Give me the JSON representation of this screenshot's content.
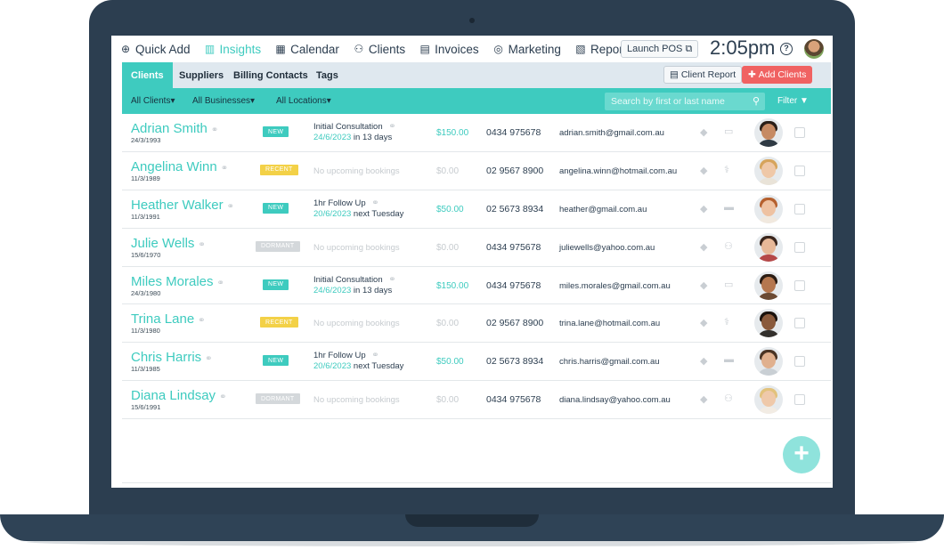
{
  "topnav": {
    "items": [
      {
        "label": "Quick Add",
        "icon": "plus-circle-icon",
        "glyph": "⊕"
      },
      {
        "label": "Insights",
        "icon": "chart-icon",
        "glyph": "▥"
      },
      {
        "label": "Calendar",
        "icon": "calendar-icon",
        "glyph": "▦"
      },
      {
        "label": "Clients",
        "icon": "users-icon",
        "glyph": "⚇"
      },
      {
        "label": "Invoices",
        "icon": "invoice-icon",
        "glyph": "▤"
      },
      {
        "label": "Marketing",
        "icon": "target-icon",
        "glyph": "◎"
      },
      {
        "label": "Reports",
        "icon": "report-icon",
        "glyph": "▧"
      }
    ],
    "active_item": "Insights",
    "launch_pos": "Launch POS",
    "clock": "2:05pm",
    "help": "?"
  },
  "subnav": {
    "tabs": [
      "Clients",
      "Suppliers",
      "Billing Contacts",
      "Tags"
    ],
    "active_tab": "Clients",
    "client_report": "Client Report",
    "add_clients": "Add Clients"
  },
  "filters": {
    "clients": "All Clients",
    "businesses": "All Businesses",
    "locations": "All Locations",
    "search_placeholder": "Search by first or last name",
    "filter": "Filter"
  },
  "colors": {
    "accent": "#3ecbbf",
    "danger": "#f06262",
    "recent": "#f3d147",
    "dormant": "#d4d8db",
    "frame": "#2c3e50"
  },
  "clients": [
    {
      "name": "Adrian Smith",
      "dob": "24/3/1993",
      "status": "NEW",
      "booking_title": "Initial Consultation",
      "booking_date": "24/6/2023",
      "booking_rel": "in 13 days",
      "amount": "$150.00",
      "phone": "0434 975678",
      "email": "adrian.smith@gmail.com.au",
      "type_icon": "monitor-icon",
      "avatar": {
        "skin": "#c68a63",
        "hair": "#2a1f18",
        "shirt": "#2f3a44"
      }
    },
    {
      "name": "Angelina Winn",
      "dob": "11/3/1989",
      "status": "RECENT",
      "booking_none": "No upcoming bookings",
      "amount": "$0.00",
      "phone": "02 9567 8900",
      "email": "angelina.winn@hotmail.com.au",
      "type_icon": "stethoscope-icon",
      "avatar": {
        "skin": "#efc8a8",
        "hair": "#d6a45c",
        "shirt": "#e9e3d8"
      }
    },
    {
      "name": "Heather Walker",
      "dob": "11/3/1991",
      "status": "NEW",
      "booking_title": "1hr Follow Up",
      "booking_date": "20/6/2023",
      "booking_rel": "next Tuesday",
      "amount": "$50.00",
      "phone": "02 5673 8934",
      "email": "heather@gmail.com.au",
      "type_icon": "chat-icon",
      "avatar": {
        "skin": "#eec2a2",
        "hair": "#b5602e",
        "shirt": "#f1e9df"
      }
    },
    {
      "name": "Julie Wells",
      "dob": "15/6/1970",
      "status": "DORMANT",
      "booking_none": "No upcoming bookings",
      "amount": "$0.00",
      "phone": "0434 975678",
      "email": "juliewells@yahoo.com.au",
      "type_icon": "group-icon",
      "avatar": {
        "skin": "#e7b898",
        "hair": "#3a261d",
        "shirt": "#b54848"
      }
    },
    {
      "name": "Miles Morales",
      "dob": "24/3/1980",
      "status": "NEW",
      "booking_title": "Initial Consultation",
      "booking_date": "24/6/2023",
      "booking_rel": "in 13 days",
      "amount": "$150.00",
      "phone": "0434 975678",
      "email": "miles.morales@gmail.com.au",
      "type_icon": "monitor-icon",
      "avatar": {
        "skin": "#b5774f",
        "hair": "#2b1c13",
        "shirt": "#6b4a33"
      }
    },
    {
      "name": "Trina Lane",
      "dob": "11/3/1980",
      "status": "RECENT",
      "booking_none": "No upcoming bookings",
      "amount": "$0.00",
      "phone": "02 9567 8900",
      "email": "trina.lane@hotmail.com.au",
      "type_icon": "stethoscope-icon",
      "avatar": {
        "skin": "#8a5a3c",
        "hair": "#1a120d",
        "shirt": "#33302c"
      }
    },
    {
      "name": "Chris Harris",
      "dob": "11/3/1985",
      "status": "NEW",
      "booking_title": "1hr Follow Up",
      "booking_date": "20/6/2023",
      "booking_rel": "next Tuesday",
      "amount": "$50.00",
      "phone": "02 5673 8934",
      "email": "chris.harris@gmail.com.au",
      "type_icon": "chat-icon",
      "avatar": {
        "skin": "#e0b08e",
        "hair": "#4a3424",
        "shirt": "#c9cfd4"
      }
    },
    {
      "name": "Diana Lindsay",
      "dob": "15/6/1991",
      "status": "DORMANT",
      "booking_none": "No upcoming bookings",
      "amount": "$0.00",
      "phone": "0434 975678",
      "email": "diana.lindsay@yahoo.com.au",
      "type_icon": "group-icon",
      "avatar": {
        "skin": "#efc9aa",
        "hair": "#e2c27c",
        "shirt": "#f2ece4"
      }
    }
  ],
  "fab": "+"
}
